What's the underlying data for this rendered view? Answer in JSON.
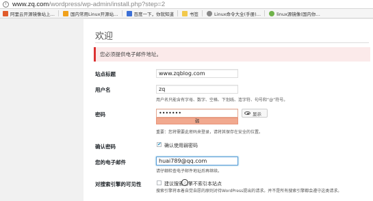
{
  "address_bar": {
    "url_host": "www.zq.com",
    "url_path": "/wordpress/wp-admin/install.php?step=2"
  },
  "bookmarks": [
    {
      "label": "阿里云开源镜像站上…",
      "color": "#e05b2b"
    },
    {
      "label": "国内常用Linux开源站…",
      "color": "#f0a11c"
    },
    {
      "label": "百度一下，你就知道",
      "color": "#3b6fd6"
    },
    {
      "label": "书签",
      "color": "#f2c94c"
    },
    {
      "label": "Linux命令大全(手册)…",
      "color": "#888888"
    },
    {
      "label": "linux源镜像(国内你…",
      "color": "#6fb24a"
    }
  ],
  "page": {
    "title": "欢迎",
    "error_message": "您必须提供电子邮件地址。",
    "site_title_label": "站点标题",
    "site_title_value": "www.zqblog.com",
    "username_label": "用户名",
    "username_value": "zq",
    "username_hint": "用户名只能含有字母、数字、空格、下划线、连字符、句号和“@”符号。",
    "password_label": "密码",
    "password_value": "•••••••",
    "show_button_label": "显示",
    "strength_label": "弱",
    "password_hint": "重要：您将需要此密码来登录，请将其保存在安全的位置。",
    "confirm_label": "确认密码",
    "confirm_checkbox_label": "确认使用弱密码",
    "email_label": "您的电子邮件",
    "email_value": "huai789@qq.com",
    "email_hint": "请仔细检查电子邮件地址后再继续。",
    "visibility_label": "对搜索引擎的可见性",
    "visibility_checkbox_label": "建议搜索引擎不索引本站点",
    "visibility_hint": "搜索引擎将本着自觉自愿的原则对待WordPress提出的请求。并不是所有搜索引擎都会遵守这类请求。"
  }
}
